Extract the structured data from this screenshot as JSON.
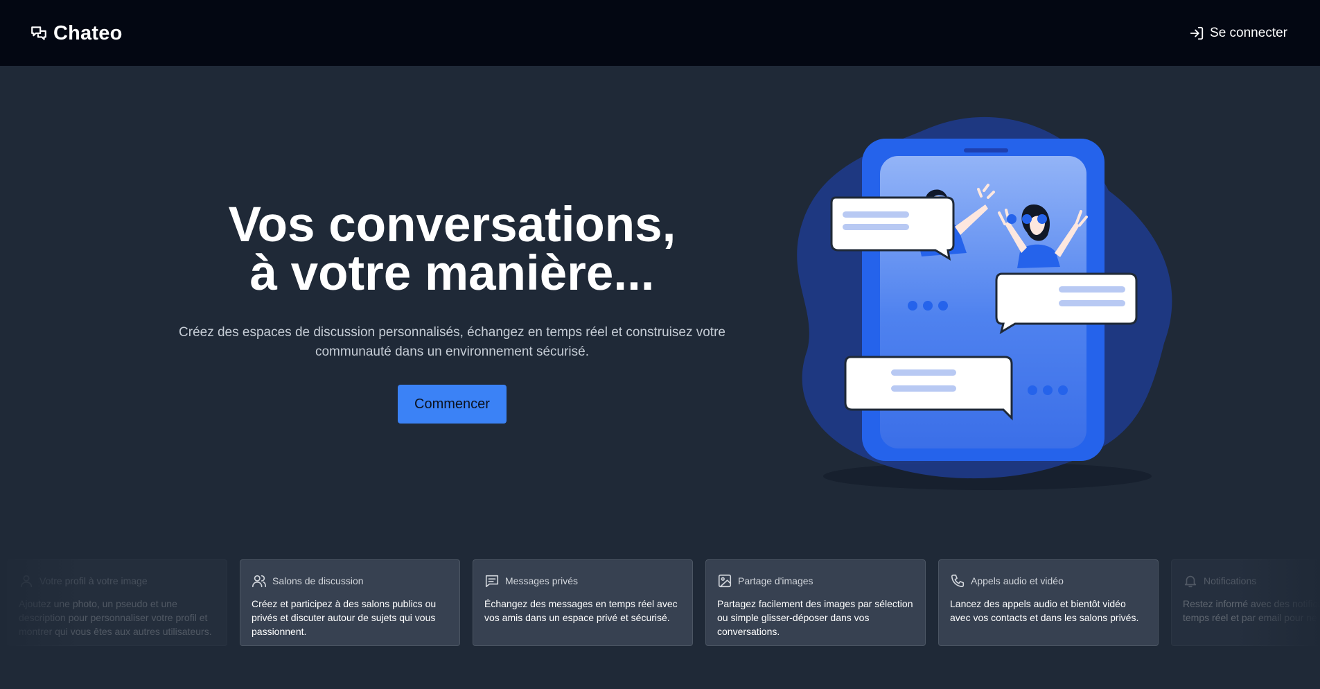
{
  "header": {
    "brand": "Chateo",
    "login_label": "Se connecter"
  },
  "hero": {
    "title_line1": "Vos conversations,",
    "title_line2": "à votre manière...",
    "subtitle_line1": "Créez des espaces de discussion personnalisés, échangez en temps réel et construisez votre",
    "subtitle_line2": "communauté dans un environnement sécurisé.",
    "cta_label": "Commencer"
  },
  "features": [
    {
      "icon": "user-icon",
      "title": "Votre profil à votre image",
      "text": "Ajoutez une photo, un pseudo et une description pour personnaliser votre profil et montrer qui vous êtes aux autres utilisateurs."
    },
    {
      "icon": "users-icon",
      "title": "Salons de discussion",
      "text": "Créez et participez à des salons publics ou privés et discuter autour de sujets qui vous passionnent."
    },
    {
      "icon": "message-square-icon",
      "title": "Messages privés",
      "text": "Échangez des messages en temps réel avec vos amis dans un espace privé et sécurisé."
    },
    {
      "icon": "image-icon",
      "title": "Partage d'images",
      "text": "Partagez facilement des images par sélection ou simple glisser-déposer dans vos conversations."
    },
    {
      "icon": "phone-icon",
      "title": "Appels audio et vidéo",
      "text": "Lancez des appels audio et bientôt vidéo avec vos contacts et dans les salons privés."
    },
    {
      "icon": "bell-icon",
      "title": "Notifications",
      "text": "Restez informé avec des notifications en temps réel et par email pour ne rien manquer."
    }
  ],
  "colors": {
    "page_bg": "#1f2937",
    "topbar_bg": "#030712",
    "accent": "#3b82f6",
    "card_bg": "#374151"
  }
}
